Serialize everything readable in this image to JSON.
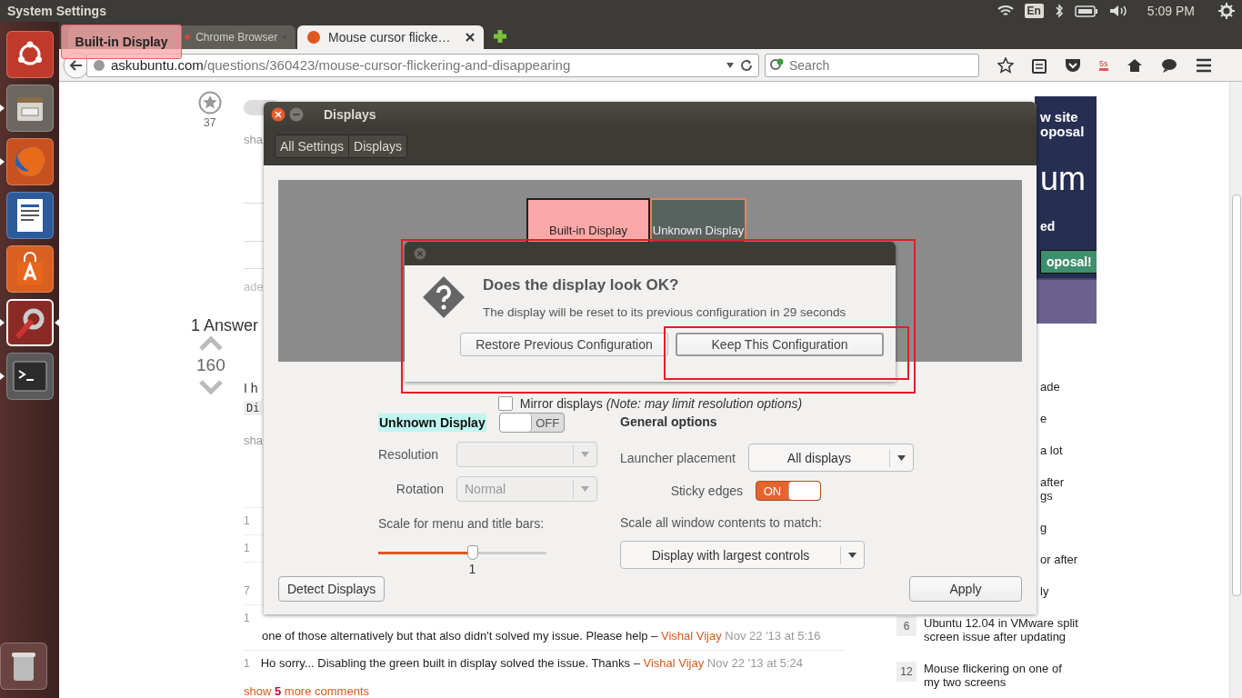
{
  "top_panel": {
    "app_title": "System Settings",
    "keyboard_layout": "En",
    "clock": "5:09 PM"
  },
  "launcher": {
    "items": [
      {
        "kind": "dash",
        "running": false,
        "selected": false
      },
      {
        "kind": "files",
        "running": true,
        "selected": false
      },
      {
        "kind": "browser",
        "running": true,
        "selected": false
      },
      {
        "kind": "writer",
        "running": false,
        "selected": false
      },
      {
        "kind": "store",
        "running": false,
        "selected": false
      },
      {
        "kind": "settings",
        "running": true,
        "selected": true
      },
      {
        "kind": "terminal",
        "running": true,
        "selected": false
      }
    ]
  },
  "browser": {
    "tabs": [
      {
        "title": "Chrome Browser",
        "selected": false
      },
      {
        "title": "Mouse cursor flicke…",
        "selected": true
      }
    ],
    "url": {
      "domain": "askubuntu.com",
      "path": "/questions/360423/mouse-cursor-flickering-and-disappearing"
    },
    "search": {
      "placeholder": "Search"
    },
    "badge": "5s"
  },
  "drag_label": "Built-in Display",
  "page": {
    "question": {
      "favorite_count": "37",
      "share": "sha",
      "add_comment": "ade"
    },
    "answers_heading": "1 Answer",
    "answer": {
      "votes": "160",
      "text": "I h",
      "code": "Di",
      "share": "sha",
      "comments": [
        {
          "score": "1"
        },
        {
          "score": "1"
        },
        {
          "score": "7"
        },
        {
          "score": "1",
          "text": "one of those alternatively but that also didn't solved my issue. Please help –",
          "user": "Vishal Vijay",
          "date": "Nov 22 '13 at 5:16"
        },
        {
          "score": "1",
          "text": "Ho sorry... Disabling the green built in display solved the issue. Thanks –",
          "user": "Vishal Vijay",
          "date": "Nov 22 '13 at 5:24"
        }
      ],
      "more_comments": "show **5** more comments"
    }
  },
  "sidebar": {
    "ad": {
      "lines": [
        "w site",
        "oposal"
      ],
      "big": "um",
      "sub": "ed",
      "button": "oposal!"
    },
    "related": [
      {
        "lines": [
          "ade"
        ]
      },
      {
        "lines": [
          "e"
        ]
      },
      {
        "lines": [
          "a lot"
        ]
      },
      {
        "lines": [
          "after",
          "gs"
        ]
      },
      {
        "lines": [
          "g"
        ]
      },
      {
        "lines": [
          "or after"
        ]
      },
      {
        "lines": [
          "ly"
        ]
      },
      {
        "count": "6",
        "title": "Ubuntu 12.04 in VMware split screen issue after updating"
      },
      {
        "count": "12",
        "title": "Mouse flickering on one of my two screens"
      }
    ]
  },
  "displays_window": {
    "title": "Displays",
    "breadcrumbs": [
      "All Settings",
      "Displays"
    ],
    "monitors": [
      {
        "label": "Built-in Display",
        "color": "#fca8a8"
      },
      {
        "label": "Unknown Display",
        "color": "#58635f"
      }
    ],
    "mirror": {
      "label": "Mirror displays *(Note: may limit resolution options)*",
      "checked": false
    },
    "display": {
      "name": "Unknown Display",
      "highlighted": true,
      "power": {
        "label": "OFF",
        "on": false
      }
    },
    "resolution": {
      "label": "Resolution",
      "disabled": true
    },
    "rotation": {
      "label": "Rotation",
      "value": "Normal",
      "disabled": true
    },
    "scale": {
      "label": "Scale for menu and title bars:",
      "level": 0.56,
      "reading": "1"
    },
    "general": {
      "heading": "General options",
      "launcher": {
        "label": "Launcher placement",
        "value": "All displays"
      },
      "sticky": {
        "label": "Sticky edges",
        "state": "ON",
        "on": true
      },
      "scale_all": {
        "label": "Scale all window contents to match:",
        "value": "Display with largest controls"
      }
    },
    "buttons": {
      "detect": "Detect Displays",
      "apply": "Apply"
    }
  },
  "confirm_dialog": {
    "title": "Does the display look OK?",
    "message": "The display will be reset to its previous configuration in 29 seconds",
    "buttons": [
      {
        "label": "Restore Previous Configuration",
        "focused": false
      },
      {
        "label": "Keep This Configuration",
        "focused": true
      }
    ]
  }
}
